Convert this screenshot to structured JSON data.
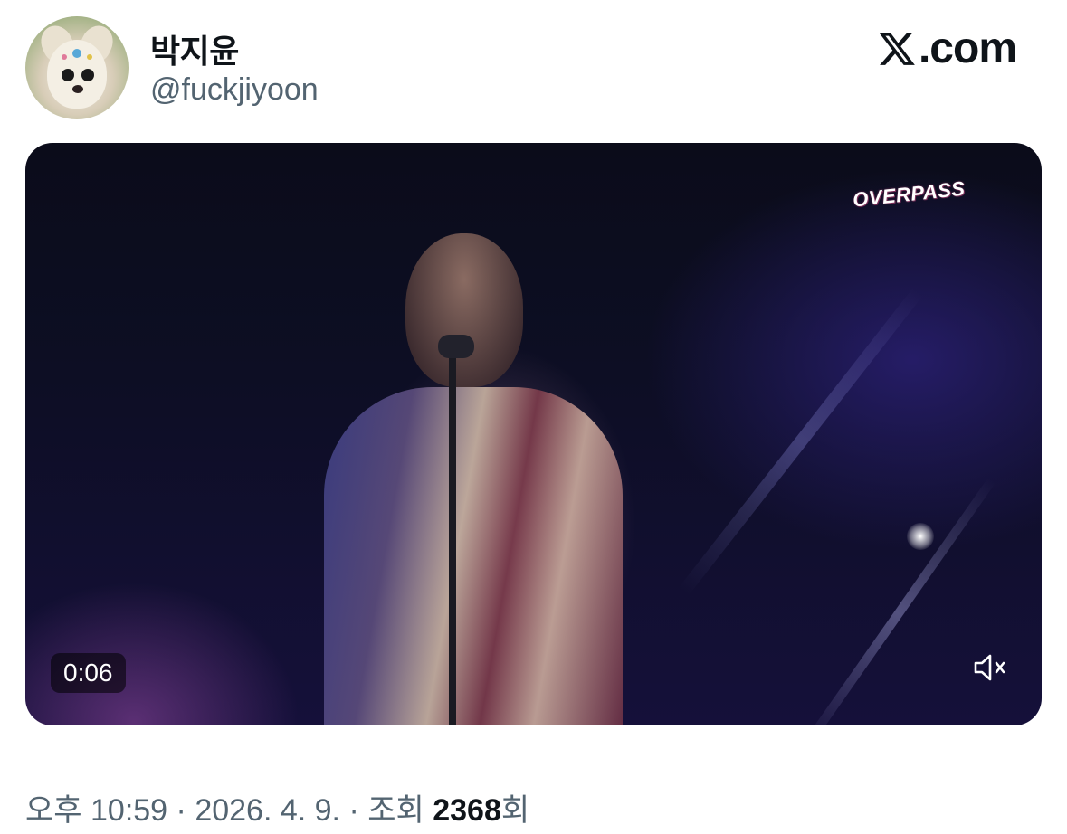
{
  "author": {
    "display_name": "박지윤",
    "handle": "@fuckjiyoon"
  },
  "brand": {
    "text": ".com",
    "icon": "x-logo-icon"
  },
  "media": {
    "watermark": "OVERPASS",
    "video_time": "0:06",
    "mute_icon": "volume-muted-icon"
  },
  "meta": {
    "time": "오후 10:59",
    "sep1": " · ",
    "date": "2026. 4. 9.",
    "sep2": " · ",
    "views_label": "조회 ",
    "views_count": "2368",
    "views_suffix": "회"
  },
  "colors": {
    "text_primary": "#0f1419",
    "text_secondary": "#536471"
  }
}
